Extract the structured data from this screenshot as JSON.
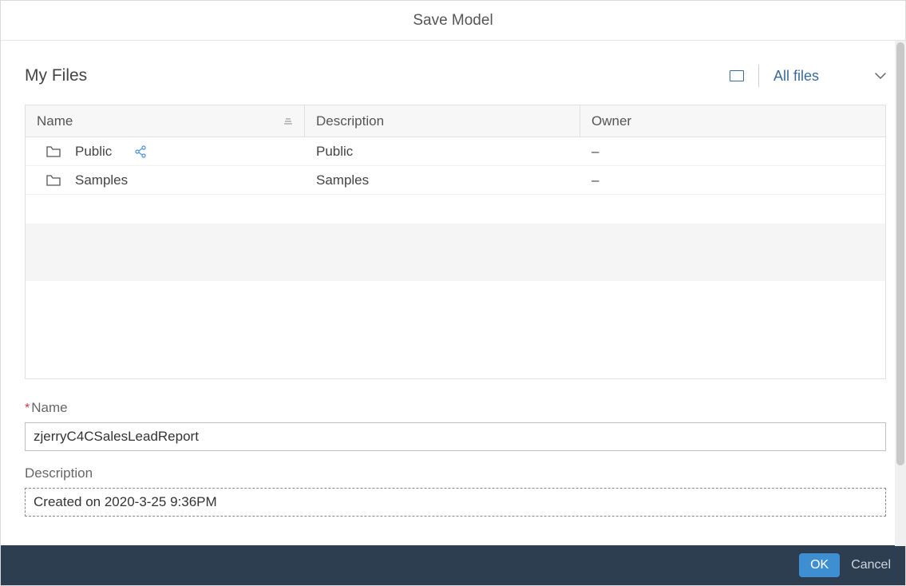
{
  "dialog": {
    "title": "Save Model"
  },
  "browser": {
    "location": "My Files",
    "filter_label": "All files"
  },
  "table": {
    "columns": {
      "name": "Name",
      "description": "Description",
      "owner": "Owner"
    },
    "rows": [
      {
        "name": "Public",
        "description": "Public",
        "owner": "–",
        "shared": true
      },
      {
        "name": "Samples",
        "description": "Samples",
        "owner": "–",
        "shared": false
      }
    ]
  },
  "form": {
    "name_label": "Name",
    "name_value": "zjerryC4CSalesLeadReport",
    "description_label": "Description",
    "description_value": "Created on 2020-3-25 9:36PM"
  },
  "footer": {
    "ok": "OK",
    "cancel": "Cancel"
  }
}
